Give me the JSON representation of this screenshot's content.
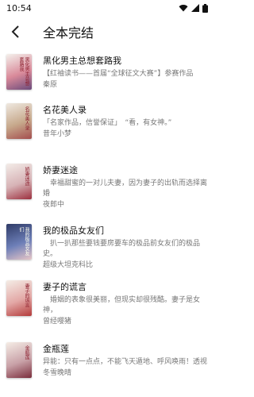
{
  "status": {
    "time": "10:54"
  },
  "header": {
    "title": "全本完结"
  },
  "books": [
    {
      "title": "黑化男主总想套路我",
      "desc": "【红袖读书——首届“全球征文大赛”】参赛作品",
      "author": "秦原",
      "cover_colors": [
        "#f4f1ec",
        "#d98a9a",
        "#6b4a7a"
      ],
      "cover_text": "黑化男主总想套路我"
    },
    {
      "title": "名花美人录",
      "desc": "「名家作品，信誉保证」　“看，有女神。”",
      "author": "昔年小梦",
      "cover_colors": [
        "#efe9e1",
        "#c7a98c",
        "#a34d4d"
      ],
      "cover_text": "名花美人录"
    },
    {
      "title": "娇妻迷途",
      "desc": "　幸福甜蜜的一对儿夫妻，因为妻子的出轨而选择离婚",
      "author": "夜郎中",
      "cover_colors": [
        "#f3ece8",
        "#d7b3b6",
        "#9c2f3e"
      ],
      "cover_text": "娇妻迷途"
    },
    {
      "title": "我的极品女友们",
      "desc": "　扒一扒那些要钱要房要车的极品前女友们的极品史。",
      "author": "超级大坦克科比",
      "cover_colors": [
        "#2f3b67",
        "#6d7fb8",
        "#e7c6c7"
      ],
      "cover_text": "我的极品女友们"
    },
    {
      "title": "妻子的谎言",
      "desc": "　婚姻的表象很美丽，但现实却很残酷。妻子是女神，",
      "author": "曾经嘤猪",
      "cover_colors": [
        "#f4ede6",
        "#e3a8a6",
        "#b33a3a"
      ],
      "cover_text": "妻子的谎言"
    },
    {
      "title": "金瓶莲",
      "desc": "异能：只有一点点，不能飞天遁地、呼风唤雨！透视",
      "author": "冬雪晚晴",
      "cover_colors": [
        "#f5ede6",
        "#c9a2a8",
        "#7b2d3c"
      ],
      "cover_text": "金瓶莲"
    }
  ]
}
